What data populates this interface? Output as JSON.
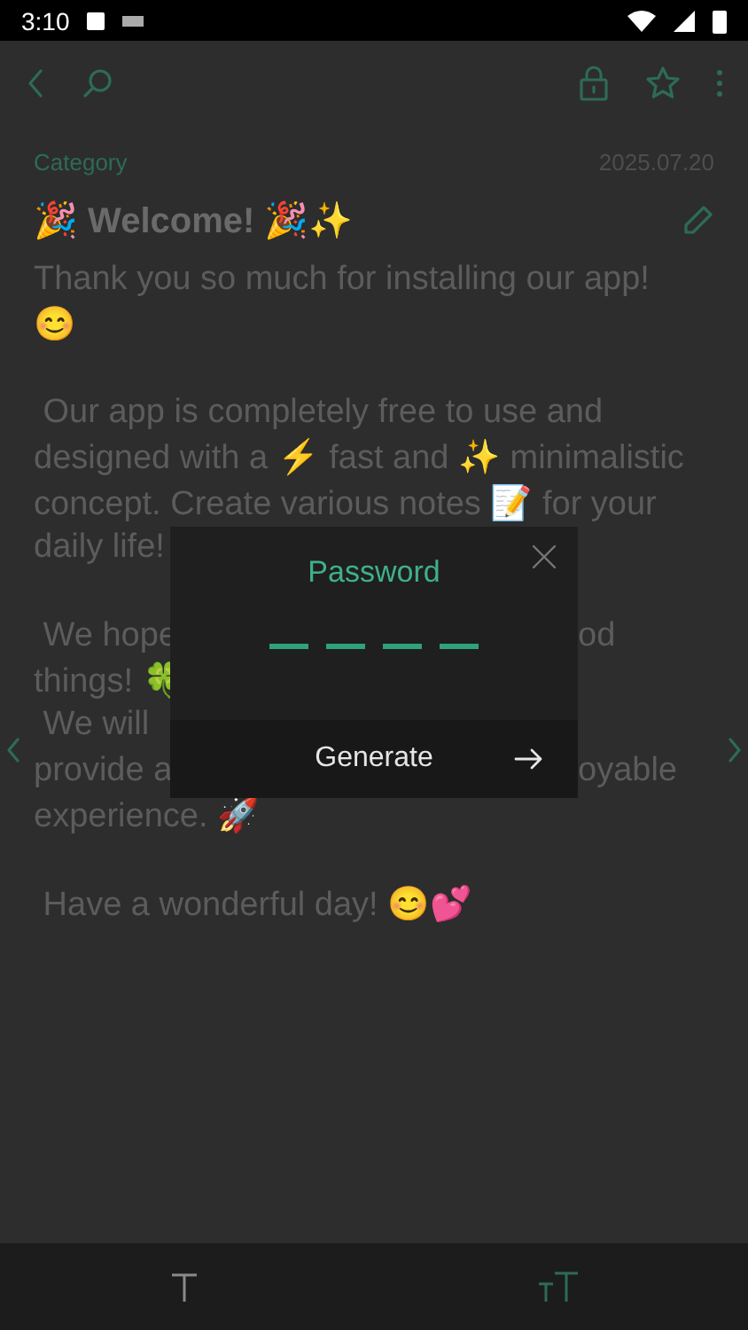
{
  "status_bar": {
    "time": "3:10"
  },
  "note": {
    "category": "Category",
    "date": "2025.07.20",
    "title": "🎉 Welcome! 🎉✨",
    "paragraphs": [
      [
        {
          "left": "Thank you so much for installing our app!"
        },
        {
          "left": "😊"
        }
      ],
      [
        {
          "left": " Our app is completely free to use and"
        },
        {
          "left": "designed with a ⚡ fast and ✨ minimalistic"
        },
        {
          "left": "concept. Create various notes 📝 for your"
        },
        {
          "left": "daily life!"
        }
      ],
      [
        {
          "left": " We hope",
          "right": "od"
        },
        {
          "left": "things! 🍀"
        },
        {
          "left": " We will"
        },
        {
          "left": "provide a",
          "right": "oyable"
        },
        {
          "left": "experience. 🚀"
        }
      ],
      [
        {
          "left": " Have a wonderful day! 😊💕"
        }
      ]
    ]
  },
  "dialog": {
    "title": "Password",
    "pin_slots": [
      {
        "filled": false
      },
      {
        "filled": false
      },
      {
        "filled": false
      },
      {
        "filled": false
      }
    ],
    "button": "Generate"
  },
  "bottom_bar": [
    {
      "kind": "text",
      "selected": false
    },
    {
      "kind": "size",
      "selected": true
    }
  ]
}
